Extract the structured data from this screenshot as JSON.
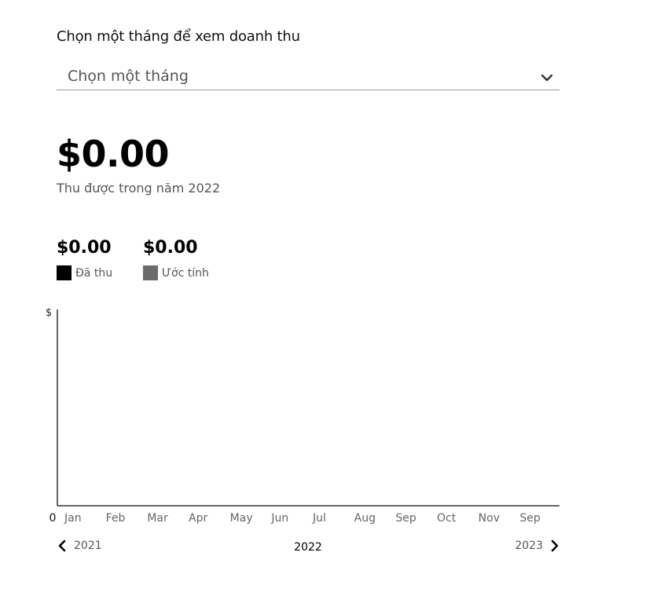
{
  "month_select": {
    "label": "Chọn một tháng để xem doanh thu",
    "placeholder": "Chọn một tháng"
  },
  "total": {
    "amount": "$0.00",
    "caption": "Thu được trong năm 2022"
  },
  "summary": {
    "collected": {
      "amount": "$0.00",
      "label": "Đã thu",
      "color": "#000000"
    },
    "estimate": {
      "amount": "$0.00",
      "label": "Ước tính",
      "color": "#6b6b6b"
    }
  },
  "chart_data": {
    "type": "bar",
    "ylabel": "$",
    "y_tick_labels": [
      "0"
    ],
    "categories": [
      "Jan",
      "Feb",
      "Mar",
      "Apr",
      "May",
      "Jun",
      "Jul",
      "Aug",
      "Sep",
      "Oct",
      "Nov",
      "Sep"
    ],
    "series": [
      {
        "name": "Đã thu",
        "values": [
          0,
          0,
          0,
          0,
          0,
          0,
          0,
          0,
          0,
          0,
          0,
          0
        ],
        "color": "#000000"
      },
      {
        "name": "Ước tính",
        "values": [
          0,
          0,
          0,
          0,
          0,
          0,
          0,
          0,
          0,
          0,
          0,
          0
        ],
        "color": "#6b6b6b"
      }
    ]
  },
  "year_nav": {
    "prev": "2021",
    "current": "2022",
    "next": "2023"
  }
}
